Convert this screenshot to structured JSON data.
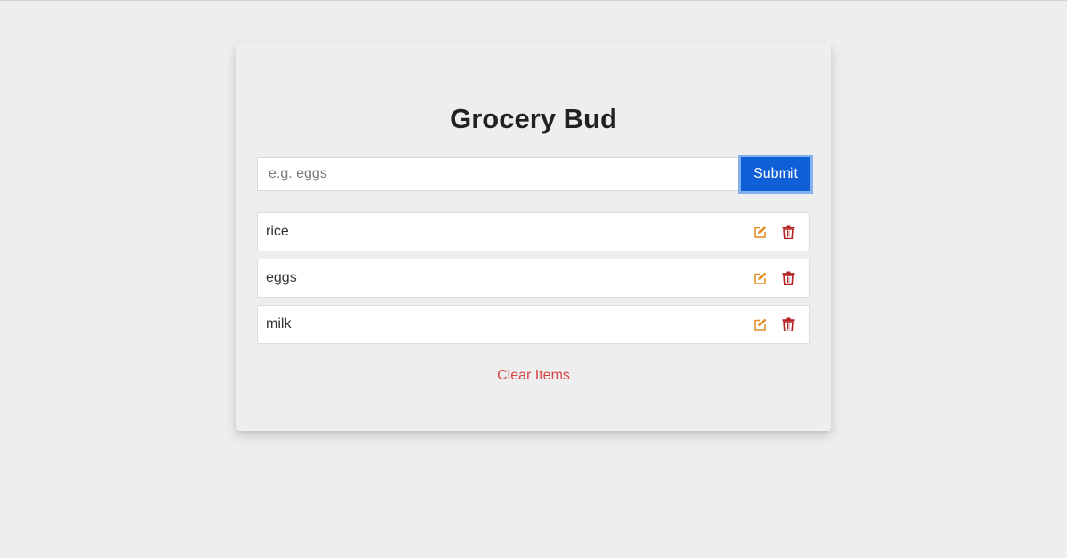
{
  "app": {
    "title": "Grocery Bud"
  },
  "form": {
    "input_value": "",
    "input_placeholder": "e.g. eggs",
    "submit_label": "Submit"
  },
  "list": {
    "items": [
      {
        "label": "rice",
        "edit_icon": "edit-icon",
        "delete_icon": "trash-icon"
      },
      {
        "label": "eggs",
        "edit_icon": "edit-icon",
        "delete_icon": "trash-icon"
      },
      {
        "label": "milk",
        "edit_icon": "edit-icon",
        "delete_icon": "trash-icon"
      }
    ]
  },
  "footer": {
    "clear_label": "Clear Items"
  },
  "colors": {
    "background": "#eeeeee",
    "accent": "#0f5fd6",
    "edit": "#e38b1e",
    "delete": "#b52222",
    "clear": "#d84444"
  }
}
